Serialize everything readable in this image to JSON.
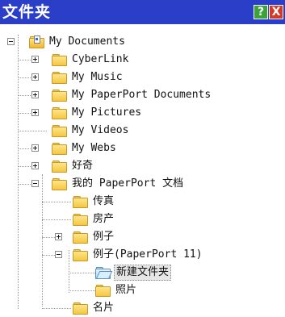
{
  "window": {
    "title": "文件夹",
    "help_glyph": "?",
    "close_glyph": "X",
    "titlebar_color": "#2a3ec8"
  },
  "tree": {
    "root": "My Documents",
    "items": [
      {
        "label": "CyberLink",
        "expander": "plus"
      },
      {
        "label": "My Music",
        "expander": "plus"
      },
      {
        "label": "My PaperPort Documents",
        "expander": "plus"
      },
      {
        "label": "My Pictures",
        "expander": "plus"
      },
      {
        "label": "My Videos",
        "expander": "none"
      },
      {
        "label": "My Webs",
        "expander": "plus"
      },
      {
        "label": "好奇",
        "expander": "plus"
      },
      {
        "label": "我的 PaperPort 文档",
        "expander": "minus"
      },
      {
        "label": "传真",
        "expander": "none"
      },
      {
        "label": "房产",
        "expander": "none"
      },
      {
        "label": "例子",
        "expander": "plus"
      },
      {
        "label": "例子(PaperPort 11)",
        "expander": "minus"
      },
      {
        "label": "新建文件夹",
        "expander": "none",
        "selected": true,
        "icon": "open-folder-icon"
      },
      {
        "label": "照片",
        "expander": "none"
      },
      {
        "label": "名片",
        "expander": "none"
      }
    ]
  }
}
